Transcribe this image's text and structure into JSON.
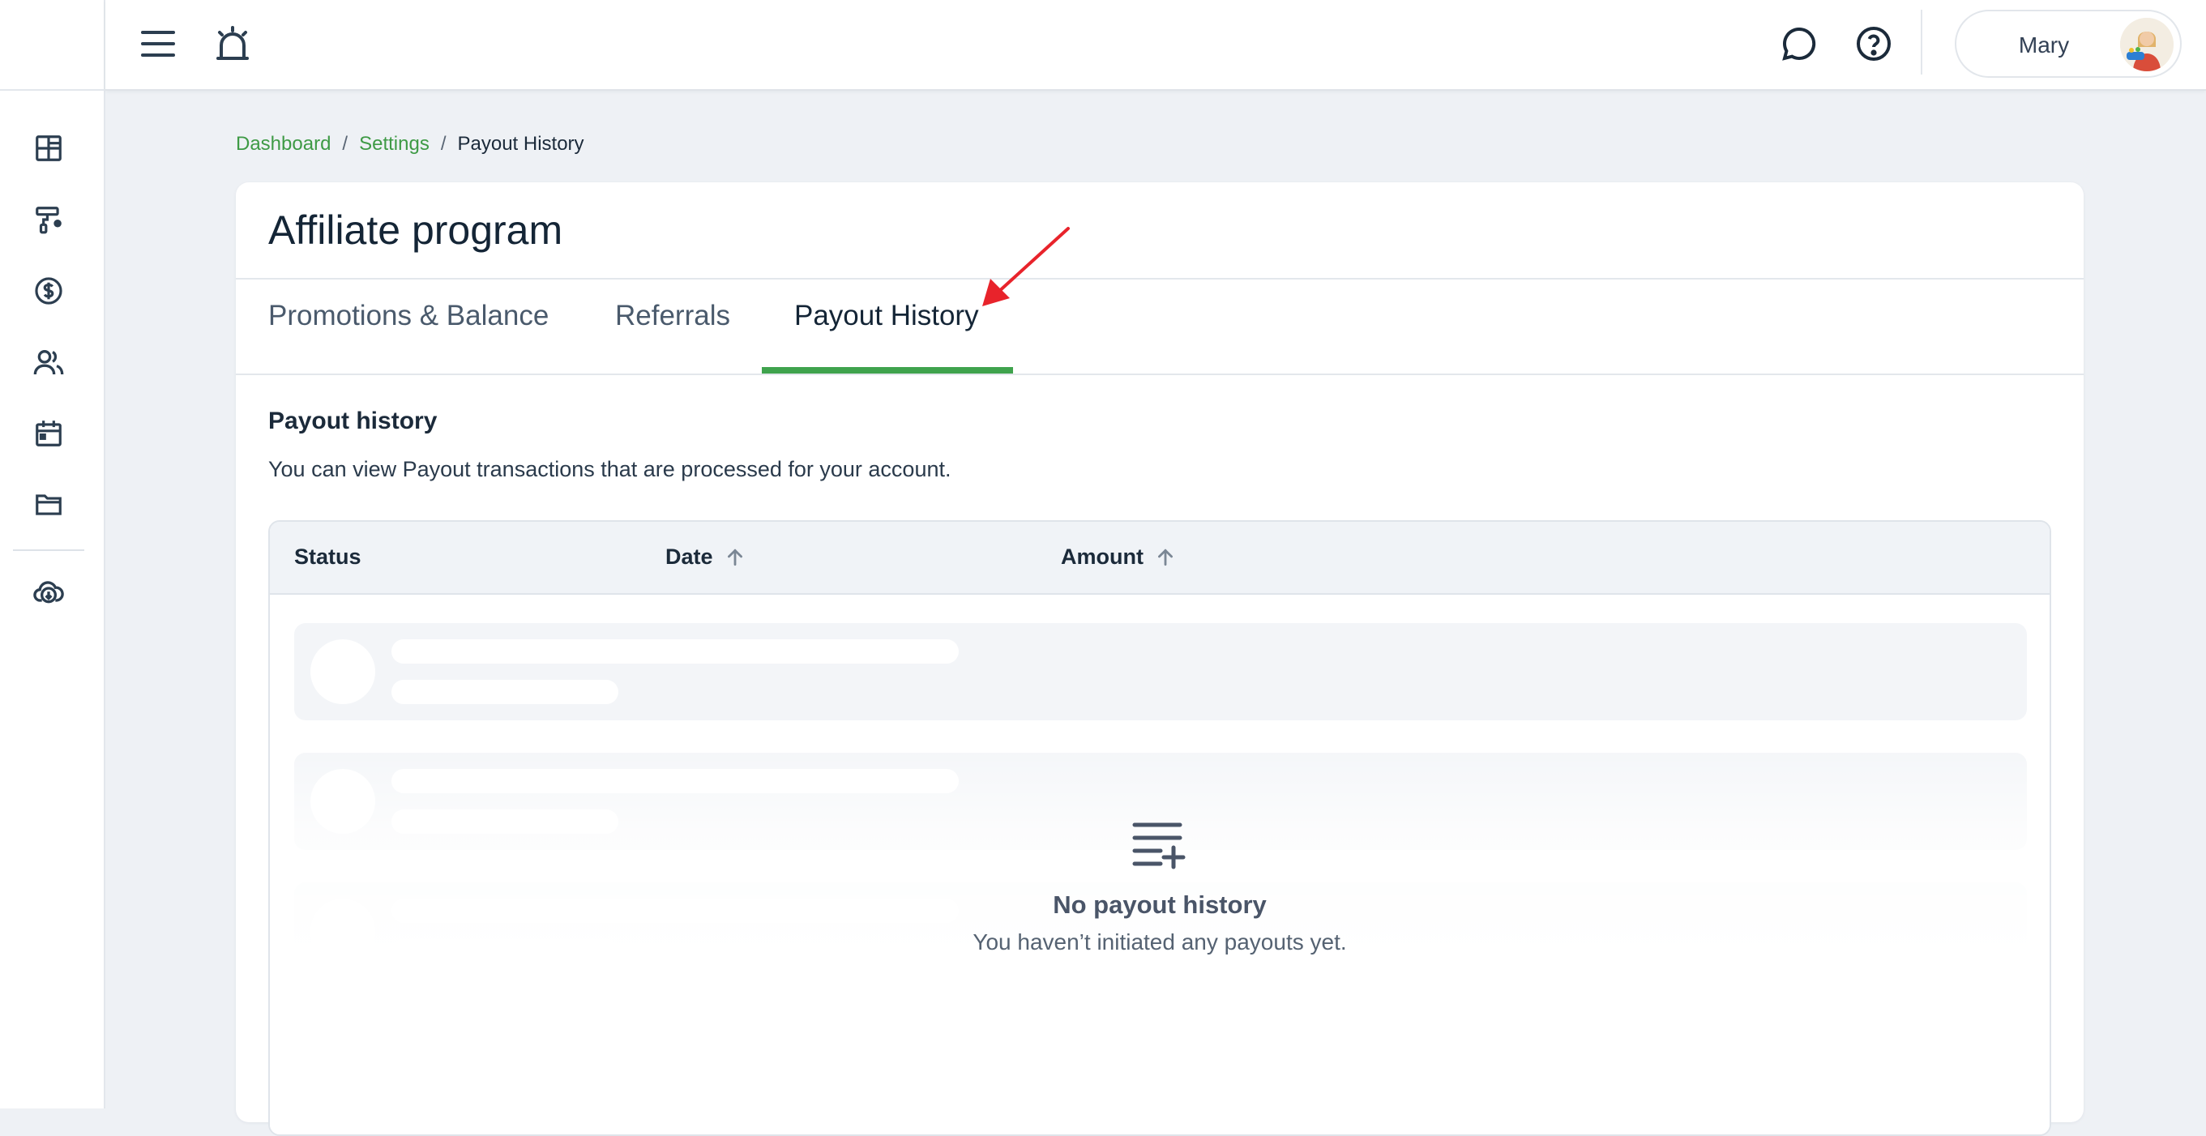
{
  "header": {
    "user_name": "Mary"
  },
  "breadcrumb": {
    "items": [
      "Dashboard",
      "Settings"
    ],
    "separator": "/",
    "current": "Payout History"
  },
  "page": {
    "title": "Affiliate program",
    "tabs": [
      {
        "label": "Promotions & Balance"
      },
      {
        "label": "Referrals"
      },
      {
        "label": "Payout History"
      }
    ],
    "active_tab": "Payout History"
  },
  "section": {
    "title": "Payout history",
    "description": "You can view Payout transactions that are processed for your account."
  },
  "table": {
    "columns": [
      {
        "label": "Status"
      },
      {
        "label": "Date",
        "sort_icon": "arrow-up-icon"
      },
      {
        "label": "Amount",
        "sort_icon": "arrow-up-icon"
      }
    ]
  },
  "empty_state": {
    "title": "No payout history",
    "subtitle": "You haven’t initiated any payouts yet.",
    "icon": "list-add-icon"
  },
  "colors": {
    "accent_green": "#3fa34d",
    "link_green": "#3e9a45",
    "annotation_red": "#e8232b"
  }
}
